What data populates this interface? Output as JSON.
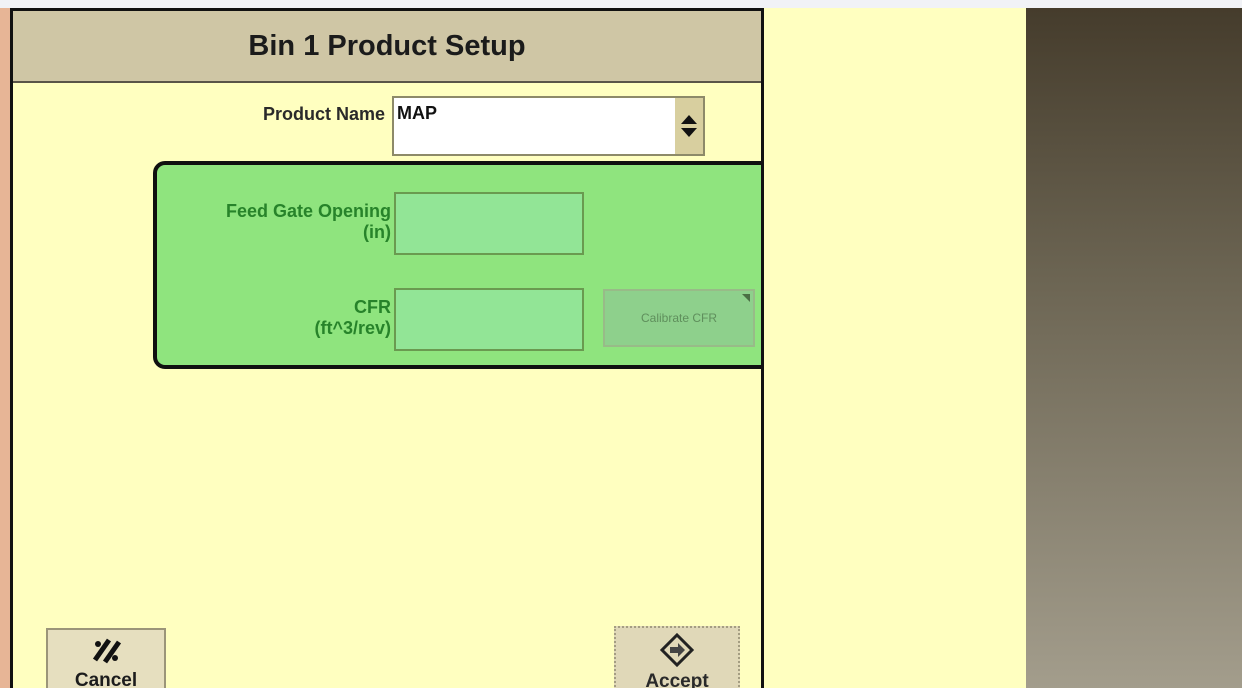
{
  "dialog": {
    "title": "Bin 1 Product Setup",
    "product_name": {
      "label": "Product Name",
      "value": "MAP"
    },
    "feed_gate": {
      "label_line1": "Feed Gate Opening",
      "label_line2": "(in)",
      "value": ""
    },
    "cfr": {
      "label_line1": "CFR",
      "label_line2": "(ft^3/rev)",
      "value": "",
      "calibrate_label": "Calibrate CFR"
    },
    "buttons": {
      "cancel_label": "Cancel",
      "accept_label": "Accept"
    }
  },
  "colors": {
    "background": "#ffffc0",
    "titlebar": "#cfc6a5",
    "highlight": "#64da64",
    "highlight_text": "#27832a"
  },
  "icons": [
    "spinner-updown-icon",
    "cancel-slash-icon",
    "accept-diamond-icon"
  ]
}
